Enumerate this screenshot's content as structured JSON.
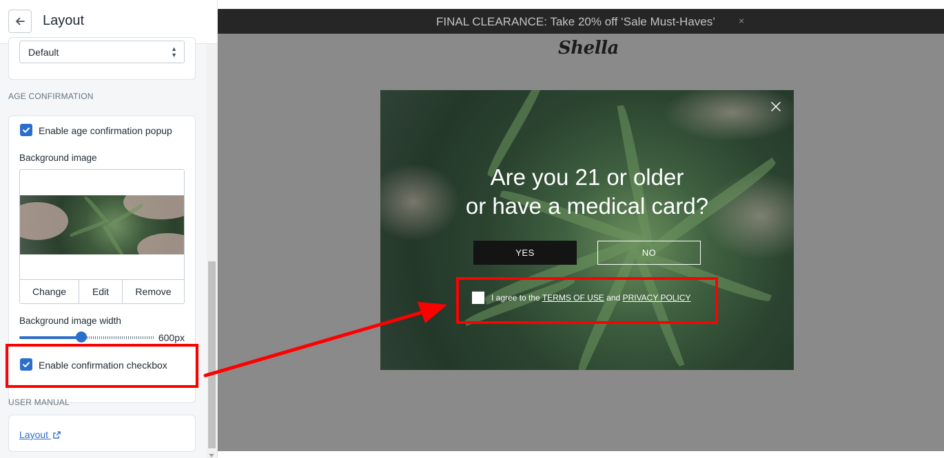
{
  "header": {
    "title": "Layout"
  },
  "layout_select": {
    "value": "Default"
  },
  "age_confirmation": {
    "section_label": "AGE CONFIRMATION",
    "enable_popup_label": "Enable age confirmation popup",
    "enable_popup_checked": true,
    "background_image_label": "Background image",
    "image_buttons": {
      "change": "Change",
      "edit": "Edit",
      "remove": "Remove"
    },
    "width_label": "Background image width",
    "width_value": "600px",
    "width_slider_fraction": 0.46,
    "enable_checkbox_label": "Enable confirmation checkbox",
    "enable_checkbox_checked": true
  },
  "user_manual": {
    "section_label": "USER MANUAL",
    "link_label": "Layout"
  },
  "preview": {
    "announcement": "FINAL CLEARANCE: Take 20% off ‘Sale Must-Haves’",
    "announcement_close": "×",
    "logo": "Shella",
    "popup": {
      "title_line1": "Are you 21 or older",
      "title_line2": "or have a medical card?",
      "yes_label": "YES",
      "no_label": "NO",
      "agree_prefix": "I agree to the ",
      "terms_link": "TERMS OF USE",
      "agree_and": " and ",
      "privacy_link": "PRIVACY POLICY"
    }
  },
  "colors": {
    "accent": "#2c6ecb",
    "annotation": "#ff0000",
    "preview_bg": "#8a8a8a",
    "announcement_bg": "#262626"
  },
  "icons": {
    "back": "arrow-left-icon",
    "select": "select-arrows-icon",
    "checkbox": "checkmark-icon",
    "external_link": "external-link-icon",
    "popup_close": "close-icon"
  }
}
